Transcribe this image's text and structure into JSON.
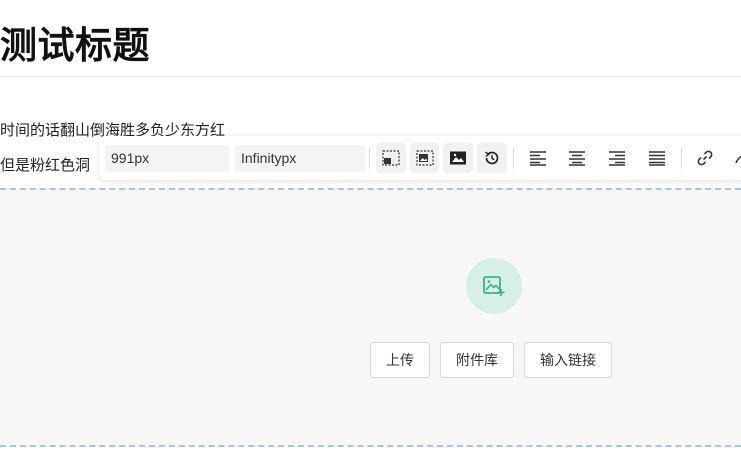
{
  "document": {
    "title": "测试标题",
    "paragraphs": [
      "时间的话翻山倒海胜多负少东方红",
      "但是粉红色洞"
    ]
  },
  "toolbar": {
    "width_value": "991px",
    "height_value": "Infinitypx",
    "buttons": [
      "image-inline-small-icon",
      "image-inline-large-icon",
      "image-block-icon",
      "reset-icon",
      "align-left-icon",
      "align-center-icon",
      "align-right-icon",
      "align-justify-icon",
      "link-icon",
      "more-icon"
    ]
  },
  "upload": {
    "icon": "add-image-icon",
    "accent_color": "#3db488",
    "buttons": {
      "upload": "上传",
      "library": "附件库",
      "link": "输入链接"
    }
  }
}
